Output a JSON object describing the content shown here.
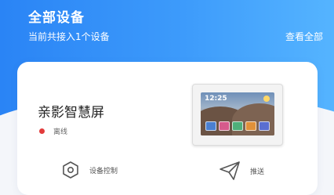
{
  "header": {
    "title": "全部设备",
    "subtitle": "当前共接入1个设备",
    "view_all": "查看全部"
  },
  "device": {
    "name": "亲影智慧屏",
    "status": "离线",
    "status_color": "#e23b3b",
    "screen_time": "12:25"
  },
  "actions": {
    "control_label": "设备控制",
    "control_icon": "hexagon-settings-icon",
    "send_label": "推送",
    "send_icon": "paper-plane-icon"
  },
  "colors": {
    "accent": "#2a84f5",
    "accent_light": "#55b4ff"
  }
}
